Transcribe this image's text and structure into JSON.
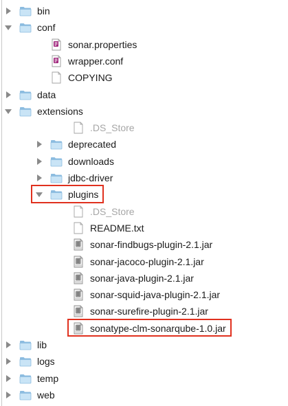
{
  "tree": [
    {
      "label": "bin",
      "type": "folder",
      "depth": 0,
      "expanded": false
    },
    {
      "label": "conf",
      "type": "folder",
      "depth": 0,
      "expanded": true
    },
    {
      "label": "sonar.properties",
      "type": "doc",
      "depth": 1
    },
    {
      "label": "wrapper.conf",
      "type": "doc",
      "depth": 1
    },
    {
      "label": "COPYING",
      "type": "file",
      "depth": 1
    },
    {
      "label": "data",
      "type": "folder",
      "depth": 0,
      "expanded": false
    },
    {
      "label": "extensions",
      "type": "folder",
      "depth": 0,
      "expanded": true
    },
    {
      "label": ".DS_Store",
      "type": "file",
      "depth": 2,
      "hidden": true
    },
    {
      "label": "deprecated",
      "type": "folder",
      "depth": 1,
      "expanded": false
    },
    {
      "label": "downloads",
      "type": "folder",
      "depth": 1,
      "expanded": false
    },
    {
      "label": "jdbc-driver",
      "type": "folder",
      "depth": 1,
      "expanded": false
    },
    {
      "label": "plugins",
      "type": "folder",
      "depth": 1,
      "expanded": true,
      "highlighted": true
    },
    {
      "label": ".DS_Store",
      "type": "file",
      "depth": 2,
      "hidden": true
    },
    {
      "label": "README.txt",
      "type": "file",
      "depth": 2
    },
    {
      "label": "sonar-findbugs-plugin-2.1.jar",
      "type": "jar",
      "depth": 2
    },
    {
      "label": "sonar-jacoco-plugin-2.1.jar",
      "type": "jar",
      "depth": 2
    },
    {
      "label": "sonar-java-plugin-2.1.jar",
      "type": "jar",
      "depth": 2
    },
    {
      "label": "sonar-squid-java-plugin-2.1.jar",
      "type": "jar",
      "depth": 2
    },
    {
      "label": "sonar-surefire-plugin-2.1.jar",
      "type": "jar",
      "depth": 2
    },
    {
      "label": "sonatype-clm-sonarqube-1.0.jar",
      "type": "jar",
      "depth": 2,
      "highlighted": true
    },
    {
      "label": "lib",
      "type": "folder",
      "depth": 0,
      "expanded": false
    },
    {
      "label": "logs",
      "type": "folder",
      "depth": 0,
      "expanded": false
    },
    {
      "label": "temp",
      "type": "folder",
      "depth": 0,
      "expanded": false
    },
    {
      "label": "web",
      "type": "folder",
      "depth": 0,
      "expanded": false
    }
  ],
  "colors": {
    "highlight": "#e0301e",
    "folder_light": "#c9e4f6",
    "folder_dark": "#8cbce0",
    "hidden_text": "#a6a6a6",
    "disclosure": "#8a8a8a"
  }
}
